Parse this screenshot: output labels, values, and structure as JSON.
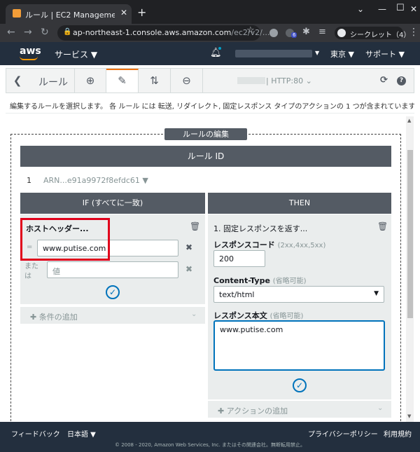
{
  "browser": {
    "tab_title": "ルール | EC2 Management Console",
    "url_host": "ap-northeast-1.console.aws.amazon.com",
    "url_path": "/ec2/v2/...",
    "incognito_label": "シークレット（4）",
    "ext_badge": "6"
  },
  "aws_header": {
    "logo": "aws",
    "services": "サービス ▼",
    "region": "東京 ▼",
    "support": "サポート ▼"
  },
  "toolbar": {
    "back": "❮",
    "title": "ルール",
    "listener": "est-alb | HTTP:80 ⌄",
    "icons": [
      "add-rule-icon",
      "edit-rule-icon",
      "reorder-rules-icon",
      "delete-rule-icon",
      "refresh-icon",
      "help-icon"
    ]
  },
  "info_text": "編集するルールを選択します。 各 ルール には 転送, リダイレクト, 固定レスポンス タイプのアクションの 1 つが含まれています。",
  "editor": {
    "label": "ルールの編集",
    "rule_id_header": "ルール ID",
    "rule_number": "1",
    "rule_arn": "ARN...e91a9972f8efdc61 ▼"
  },
  "if_panel": {
    "header": "IF (すべてに一致)",
    "condition_title": "ホストヘッダー...",
    "operator": "=",
    "value": "www.putise.com",
    "or_label": "または",
    "value_placeholder": "値",
    "add_condition": "条件の追加"
  },
  "then_panel": {
    "header": "THEN",
    "action_title": "1. 固定レスポンスを返す...",
    "response_code_label": "レスポンスコード",
    "response_code_hint": "(2xx,4xx,5xx)",
    "response_code": "200",
    "content_type_label": "Content-Type",
    "content_type_hint": "(省略可能)",
    "content_type": "text/html",
    "body_label": "レスポンス本文",
    "body_hint": "(省略可能)",
    "body": "www.putise.com",
    "add_action": "アクションの追加"
  },
  "footer": {
    "feedback": "フィードバック",
    "language": "日本語 ▼",
    "privacy": "プライバシーポリシー",
    "terms": "利用規約",
    "copyright": "© 2008 - 2020, Amazon Web Services, Inc. またはその関連会社。無断転用禁止。"
  }
}
